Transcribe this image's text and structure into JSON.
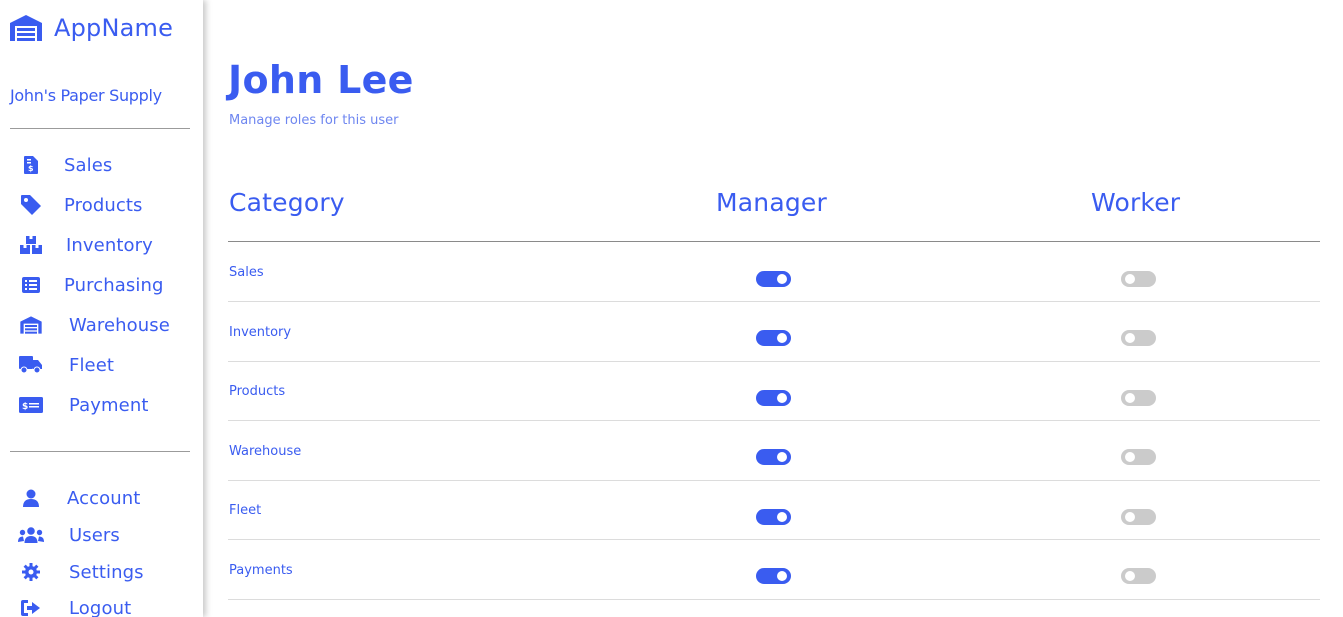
{
  "app": {
    "name": "AppName",
    "company": "John's Paper Supply"
  },
  "colors": {
    "accent": "#3a5cf0",
    "toggle_off": "#cbcbcb",
    "subtitle": "#6e86f0"
  },
  "sidebar": {
    "primary_items": [
      {
        "label": "Sales",
        "icon": "receipt-dollar-icon"
      },
      {
        "label": "Products",
        "icon": "tag-icon"
      },
      {
        "label": "Inventory",
        "icon": "boxes-icon"
      },
      {
        "label": "Purchasing",
        "icon": "list-alt-icon"
      },
      {
        "label": "Warehouse",
        "icon": "warehouse-icon"
      },
      {
        "label": "Fleet",
        "icon": "truck-icon"
      },
      {
        "label": "Payment",
        "icon": "money-check-icon"
      }
    ],
    "secondary_items": [
      {
        "label": "Account",
        "icon": "user-icon"
      },
      {
        "label": "Users",
        "icon": "users-icon"
      },
      {
        "label": "Settings",
        "icon": "cog-icon"
      },
      {
        "label": "Logout",
        "icon": "sign-out-icon"
      }
    ]
  },
  "page": {
    "title": "John Lee",
    "subtitle": "Manage roles for this user"
  },
  "table": {
    "headers": {
      "category": "Category",
      "manager": "Manager",
      "worker": "Worker"
    },
    "rows": [
      {
        "category": "Sales",
        "manager": true,
        "worker": false
      },
      {
        "category": "Inventory",
        "manager": true,
        "worker": false
      },
      {
        "category": "Products",
        "manager": true,
        "worker": false
      },
      {
        "category": "Warehouse",
        "manager": true,
        "worker": false
      },
      {
        "category": "Fleet",
        "manager": true,
        "worker": false
      },
      {
        "category": "Payments",
        "manager": true,
        "worker": false
      }
    ]
  }
}
